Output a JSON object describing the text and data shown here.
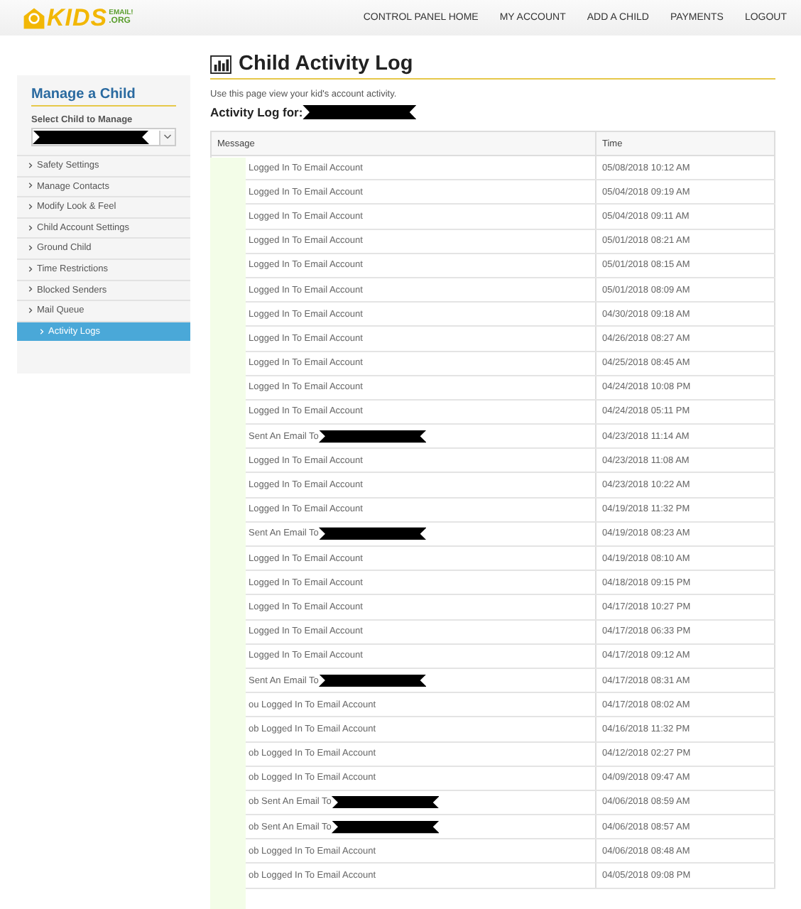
{
  "header": {
    "logo": {
      "main": "KIDS",
      "sub": "EMAIL!",
      "tld": ".ORG"
    },
    "nav": [
      "CONTROL PANEL HOME",
      "MY ACCOUNT",
      "ADD A CHILD",
      "PAYMENTS",
      "LOGOUT"
    ]
  },
  "sidebar": {
    "title": "Manage a Child",
    "select_label": "Select Child to Manage",
    "select_redacted": true,
    "items": [
      {
        "label": "Safety Settings",
        "selected": false
      },
      {
        "label": "Manage Contacts",
        "selected": false
      },
      {
        "label": "Modify Look & Feel",
        "selected": false
      },
      {
        "label": "Child Account Settings",
        "selected": false
      },
      {
        "label": "Ground Child",
        "selected": false
      },
      {
        "label": "Time Restrictions",
        "selected": false
      },
      {
        "label": "Blocked Senders",
        "selected": false
      },
      {
        "label": "Mail Queue",
        "selected": false
      },
      {
        "label": "Activity Logs",
        "selected": true
      }
    ]
  },
  "page": {
    "title": "Child Activity Log",
    "intro": "Use this page view your kid's account activity.",
    "subtitle": "Activity Log for:",
    "subtitle_redacted": true
  },
  "table": {
    "columns": [
      "Message",
      "Time"
    ],
    "rows": [
      {
        "message": "Logged In To Email Account",
        "recipient_redacted": false,
        "time": "05/08/2018 10:12 AM"
      },
      {
        "message": "Logged In To Email Account",
        "recipient_redacted": false,
        "time": "05/04/2018 09:19 AM"
      },
      {
        "message": "Logged In To Email Account",
        "recipient_redacted": false,
        "time": "05/04/2018 09:11 AM"
      },
      {
        "message": "Logged In To Email Account",
        "recipient_redacted": false,
        "time": "05/01/2018 08:21 AM"
      },
      {
        "message": "Logged In To Email Account",
        "recipient_redacted": false,
        "time": "05/01/2018 08:15 AM"
      },
      {
        "message": "Logged In To Email Account",
        "recipient_redacted": false,
        "time": "05/01/2018 08:09 AM"
      },
      {
        "message": "Logged In To Email Account",
        "recipient_redacted": false,
        "time": "04/30/2018 09:18 AM"
      },
      {
        "message": "Logged In To Email Account",
        "recipient_redacted": false,
        "time": "04/26/2018 08:27 AM"
      },
      {
        "message": "Logged In To Email Account",
        "recipient_redacted": false,
        "time": "04/25/2018 08:45 AM"
      },
      {
        "message": "Logged In To Email Account",
        "recipient_redacted": false,
        "time": "04/24/2018 10:08 PM"
      },
      {
        "message": "Logged In To Email Account",
        "recipient_redacted": false,
        "time": "04/24/2018 05:11 PM"
      },
      {
        "message": "Sent An Email To",
        "recipient_redacted": true,
        "time": "04/23/2018 11:14 AM"
      },
      {
        "message": "Logged In To Email Account",
        "recipient_redacted": false,
        "time": "04/23/2018 11:08 AM"
      },
      {
        "message": "Logged In To Email Account",
        "recipient_redacted": false,
        "time": "04/23/2018 10:22 AM"
      },
      {
        "message": "Logged In To Email Account",
        "recipient_redacted": false,
        "time": "04/19/2018 11:32 PM"
      },
      {
        "message": "Sent An Email To",
        "recipient_redacted": true,
        "time": "04/19/2018 08:23 AM"
      },
      {
        "message": "Logged In To Email Account",
        "recipient_redacted": false,
        "time": "04/19/2018 08:10 AM"
      },
      {
        "message": "Logged In To Email Account",
        "recipient_redacted": false,
        "time": "04/18/2018 09:15 PM"
      },
      {
        "message": "Logged In To Email Account",
        "recipient_redacted": false,
        "time": "04/17/2018 10:27 PM"
      },
      {
        "message": "Logged In To Email Account",
        "recipient_redacted": false,
        "time": "04/17/2018 06:33 PM"
      },
      {
        "message": "Logged In To Email Account",
        "recipient_redacted": false,
        "time": "04/17/2018 09:12 AM"
      },
      {
        "message": "Sent An Email To",
        "recipient_redacted": true,
        "time": "04/17/2018 08:31 AM"
      },
      {
        "message": "ou Logged In To Email Account",
        "recipient_redacted": false,
        "time": "04/17/2018 08:02 AM"
      },
      {
        "message": "ob Logged In To Email Account",
        "recipient_redacted": false,
        "time": "04/16/2018 11:32 PM"
      },
      {
        "message": "ob Logged In To Email Account",
        "recipient_redacted": false,
        "time": "04/12/2018 02:27 PM"
      },
      {
        "message": "ob Logged In To Email Account",
        "recipient_redacted": false,
        "time": "04/09/2018 09:47 AM"
      },
      {
        "message": "ob Sent An Email To",
        "recipient_redacted": true,
        "time": "04/06/2018 08:59 AM"
      },
      {
        "message": "ob Sent An Email To",
        "recipient_redacted": true,
        "time": "04/06/2018 08:57 AM"
      },
      {
        "message": "ob Logged In To Email Account",
        "recipient_redacted": false,
        "time": "04/06/2018 08:48 AM"
      },
      {
        "message": "ob Logged In To Email Account",
        "recipient_redacted": false,
        "time": "04/05/2018 09:08 PM"
      }
    ]
  }
}
